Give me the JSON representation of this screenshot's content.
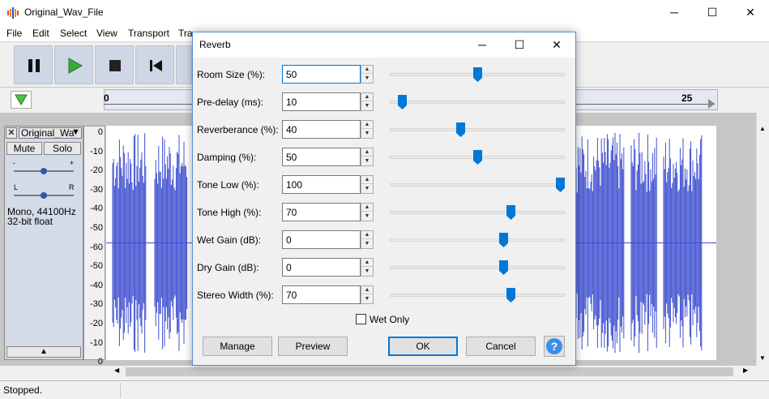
{
  "window": {
    "title": "Original_Wav_File",
    "minimize_icon": "─",
    "maximize_icon": "☐",
    "close_icon": "✕"
  },
  "menu": [
    "File",
    "Edit",
    "Select",
    "View",
    "Transport",
    "Tra"
  ],
  "timeline": {
    "start_label": "0",
    "end_label": "25"
  },
  "track": {
    "close_label": "✕",
    "name": "Original_Wa",
    "dropdown_icon": "▼",
    "mute_label": "Mute",
    "solo_label": "Solo",
    "gain_minus": "-",
    "gain_plus": "+",
    "pan_left": "L",
    "pan_right": "R",
    "info_line1": "Mono, 44100Hz",
    "info_line2": "32-bit float",
    "collapse_icon": "▲"
  },
  "vertical_ruler": [
    "0",
    "-10",
    "-20",
    "-30",
    "-40",
    "-50",
    "-60",
    "-50",
    "-40",
    "-30",
    "-20",
    "-10",
    "0"
  ],
  "status": {
    "text": "Stopped."
  },
  "dialog": {
    "title": "Reverb",
    "minimize_icon": "─",
    "maximize_icon": "☐",
    "close_icon": "✕",
    "params": [
      {
        "label": "Room Size (%):",
        "value": "50",
        "slider_fraction": 0.5
      },
      {
        "label": "Pre-delay (ms):",
        "value": "10",
        "slider_fraction": 0.05
      },
      {
        "label": "Reverberance (%):",
        "value": "40",
        "slider_fraction": 0.4
      },
      {
        "label": "Damping (%):",
        "value": "50",
        "slider_fraction": 0.5
      },
      {
        "label": "Tone Low (%):",
        "value": "100",
        "slider_fraction": 1.0
      },
      {
        "label": "Tone High (%):",
        "value": "70",
        "slider_fraction": 0.7
      },
      {
        "label": "Wet Gain (dB):",
        "value": "0",
        "slider_fraction": 0.66
      },
      {
        "label": "Dry Gain (dB):",
        "value": "0",
        "slider_fraction": 0.66
      },
      {
        "label": "Stereo Width (%):",
        "value": "70",
        "slider_fraction": 0.7
      }
    ],
    "wet_only_label": "Wet Only",
    "buttons": {
      "manage": "Manage",
      "preview": "Preview",
      "ok": "OK",
      "cancel": "Cancel",
      "help": "?"
    }
  },
  "colors": {
    "waveform": "#3f4fd0",
    "accent": "#0078d7",
    "help_circle": "#3d8ee6"
  }
}
